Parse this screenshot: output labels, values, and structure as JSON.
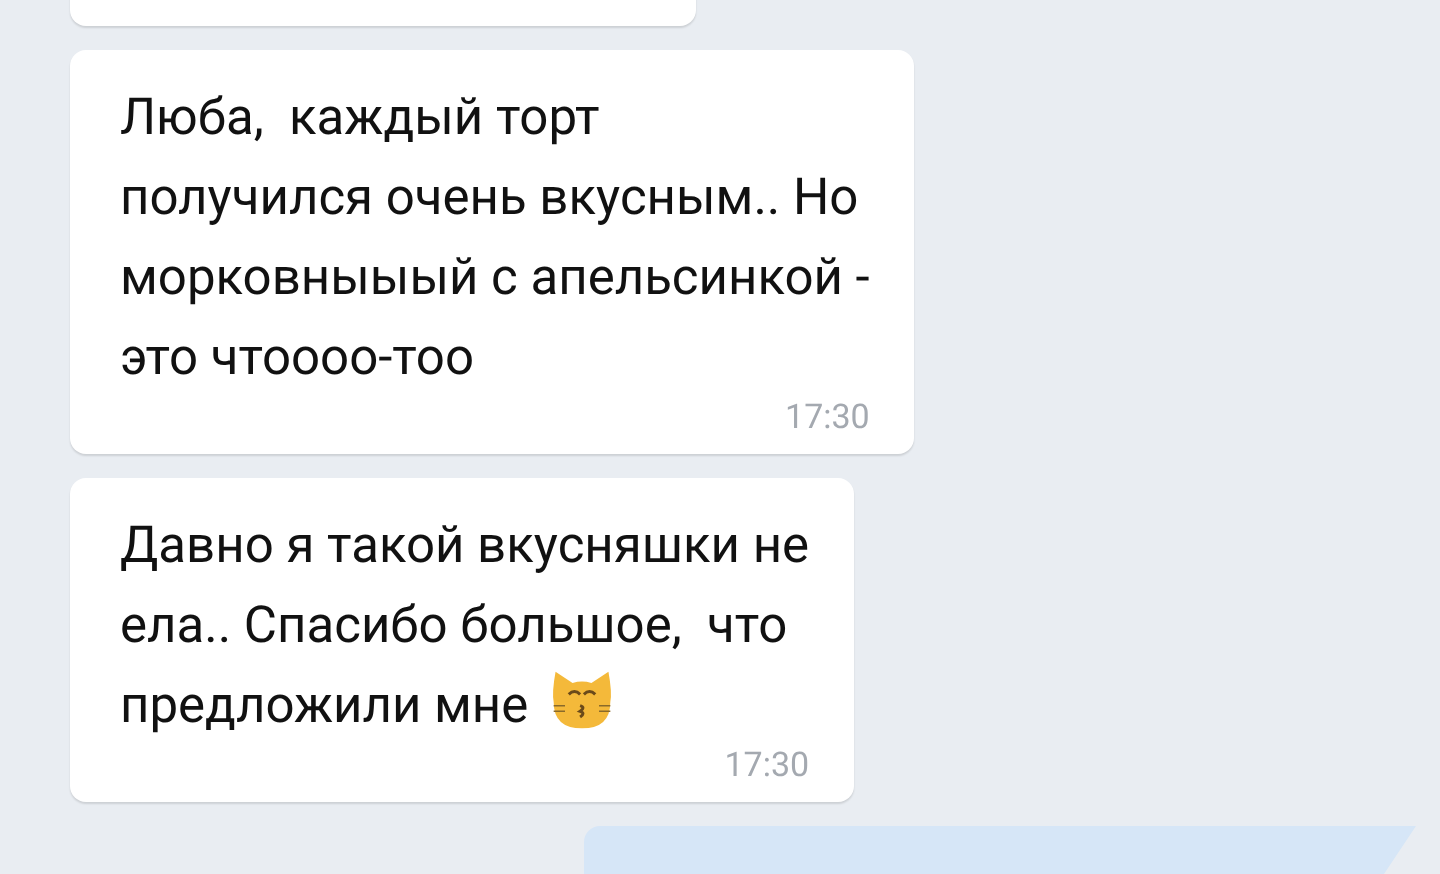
{
  "messages": [
    {
      "kind": "incoming"
    },
    {
      "kind": "incoming",
      "text": "Люба,  каждый торт\nполучился очень вкусным.. Но\nморковныыый с апельсинкой -\nэто чтоооо-тоо",
      "time": "17:30"
    },
    {
      "kind": "incoming",
      "text": "Давно я такой вкусняшки не\nела.. Спасибо большое,  что\nпредложили мне",
      "emoji": true,
      "time": "17:30"
    },
    {
      "kind": "outgoing"
    }
  ]
}
